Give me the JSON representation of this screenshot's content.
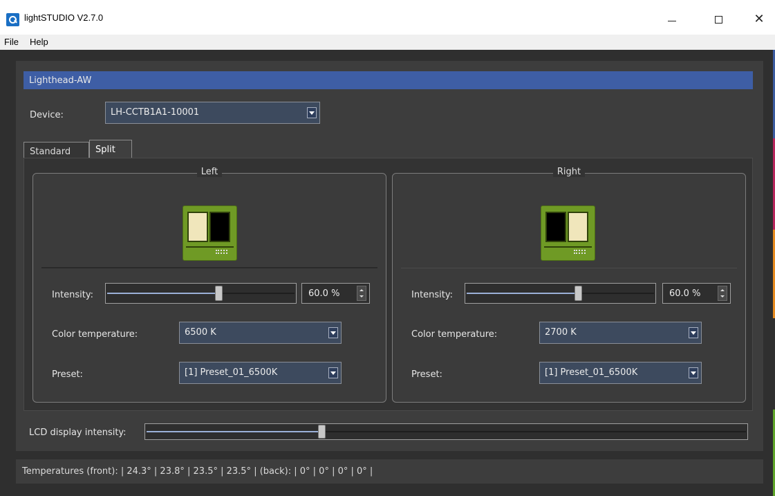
{
  "window": {
    "title": "lightSTUDIO V2.7.0",
    "icon": "app-logo-icon"
  },
  "menu": {
    "items": [
      "File",
      "Help"
    ]
  },
  "group": {
    "title": "Lighthead-AW"
  },
  "device": {
    "label": "Device:",
    "value": "LH-CCTB1A1-10001"
  },
  "tabs": {
    "standard": "Standard",
    "split": "Split",
    "active": "Split"
  },
  "left": {
    "title": "Left",
    "intensity_label": "Intensity:",
    "intensity_value": "60.0 %",
    "intensity_level": 60,
    "color_temp_label": "Color temperature:",
    "color_temp_value": "6500 K",
    "preset_label": "Preset:",
    "preset_value": "[1] Preset_01_6500K"
  },
  "right": {
    "title": "Right",
    "intensity_label": "Intensity:",
    "intensity_value": "60.0 %",
    "intensity_level": 60,
    "color_temp_label": "Color temperature:",
    "color_temp_value": "2700 K",
    "preset_label": "Preset:",
    "preset_value": "[1] Preset_01_6500K"
  },
  "lcd": {
    "label": "LCD display intensity:",
    "level": 29
  },
  "status": {
    "text": "Temperatures (front): | 24.3° | 23.8° | 23.5° | 23.5° |  (back): | 0° | 0° | 0° | 0° |"
  },
  "colors": {
    "group_header": "#3e5ea5",
    "device_icon": "#6f9a25",
    "lit_panel": "#f0e6bb",
    "strip": [
      "#3b5ba0",
      "#b8255c",
      "#e68a1e",
      "#5fa52a"
    ]
  }
}
